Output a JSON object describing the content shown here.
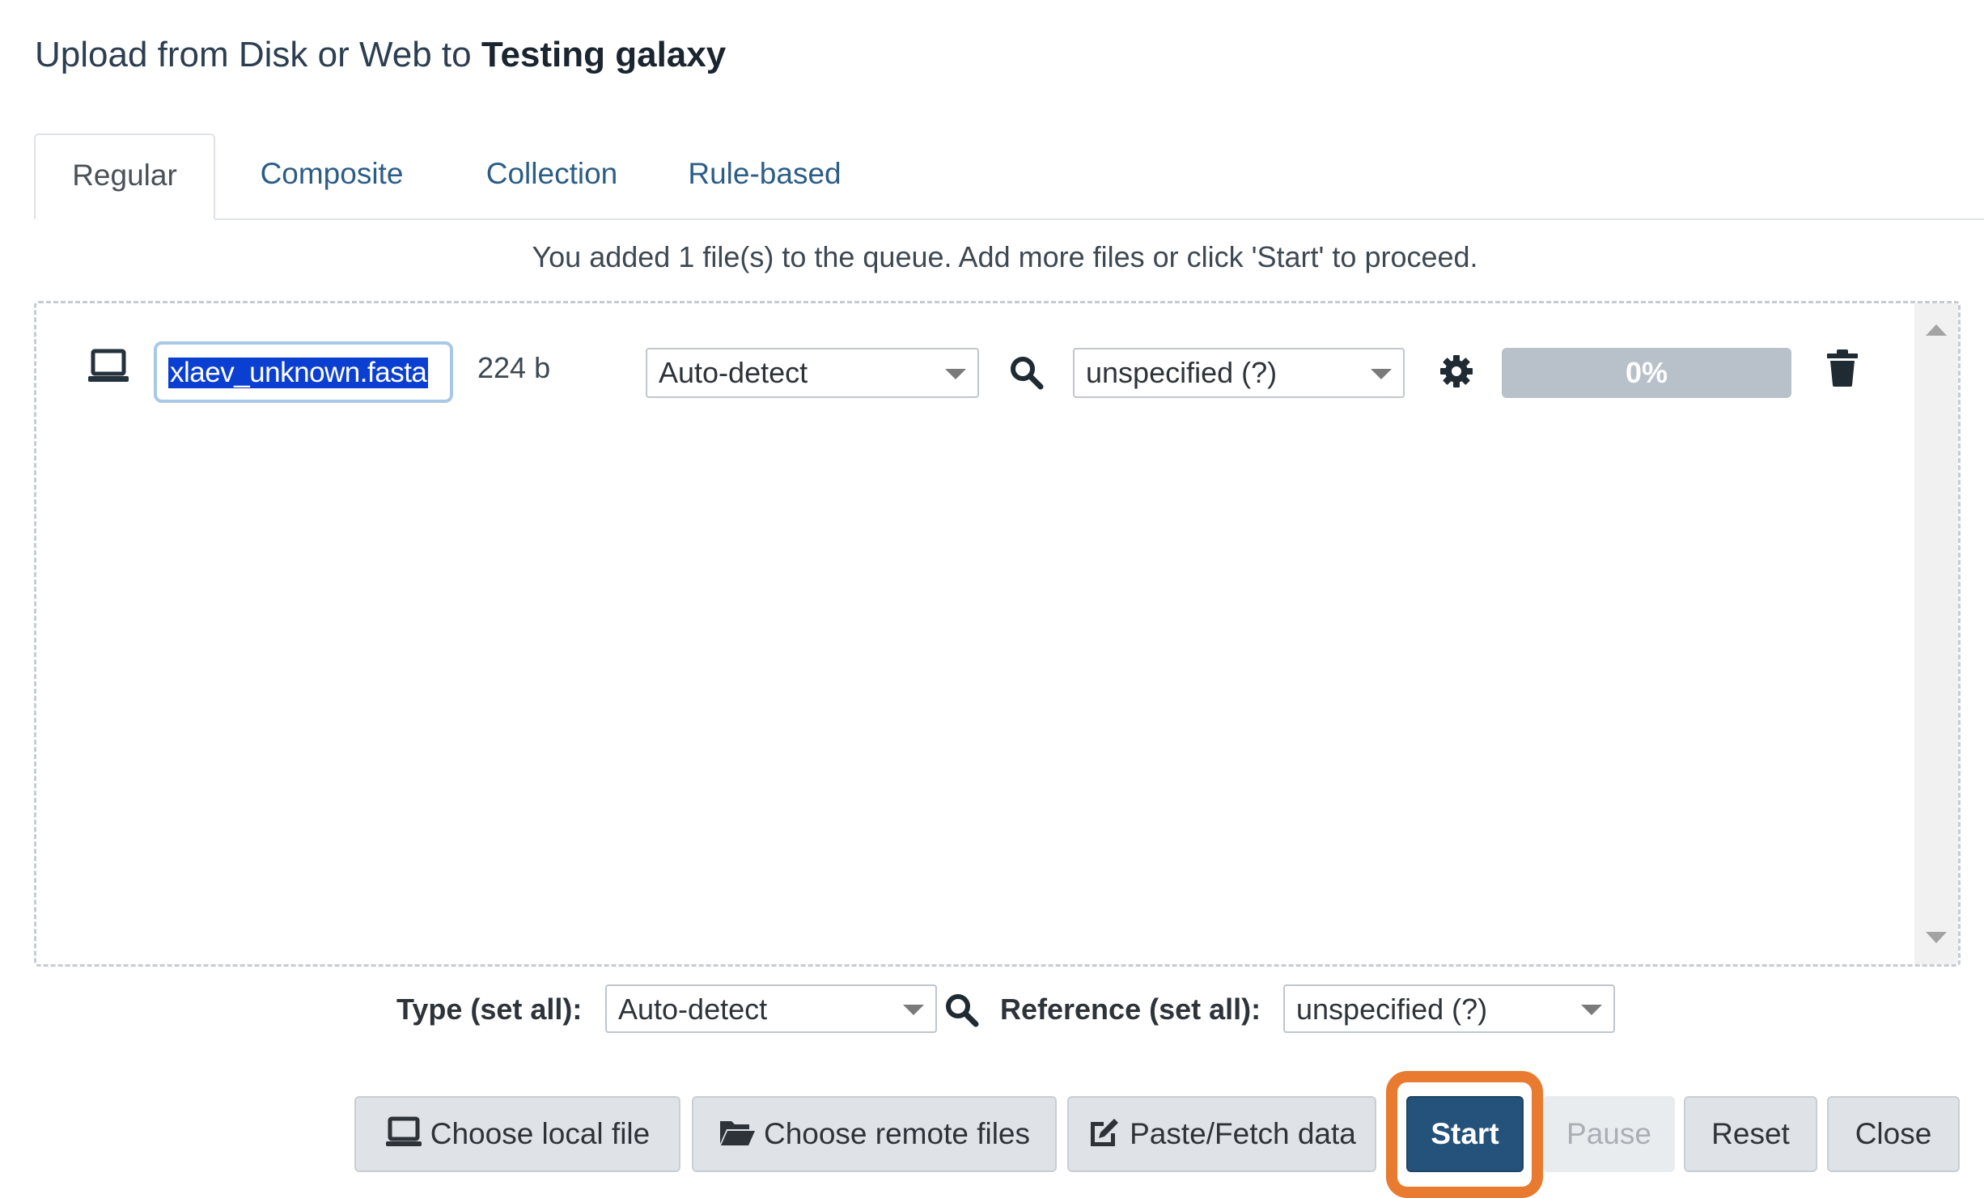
{
  "dialog": {
    "title_prefix": "Upload from Disk or Web to ",
    "title_target": "Testing galaxy"
  },
  "tabs": [
    {
      "label": "Regular",
      "active": true
    },
    {
      "label": "Composite",
      "active": false
    },
    {
      "label": "Collection",
      "active": false
    },
    {
      "label": "Rule-based",
      "active": false
    }
  ],
  "queue_message": "You added 1 file(s) to the queue. Add more files or click 'Start' to proceed.",
  "upload_row": {
    "source_icon": "laptop-icon",
    "filename": "xlaev_unknown.fasta",
    "size": "224 b",
    "type": "Auto-detect",
    "reference": "unspecified (?)",
    "progress": "0%",
    "progress_fraction": 0
  },
  "set_all": {
    "type_label": "Type (set all):",
    "type_value": "Auto-detect",
    "reference_label": "Reference (set all):",
    "reference_value": "unspecified (?)"
  },
  "buttons": {
    "choose_local": "Choose local file",
    "choose_remote": "Choose remote files",
    "paste_fetch": "Paste/Fetch data",
    "start": "Start",
    "pause": "Pause",
    "reset": "Reset",
    "close": "Close"
  },
  "colors": {
    "primary": "#25527a",
    "highlight": "#e87b2f",
    "progress_bg": "#b8c1ca",
    "selection": "#0b3fd1"
  }
}
